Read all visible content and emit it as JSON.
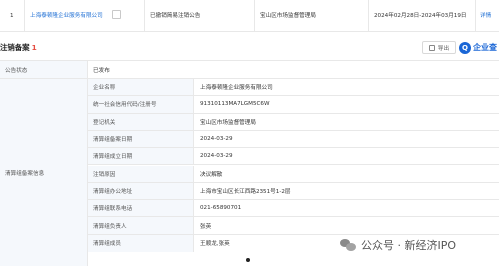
{
  "top_row": {
    "index": "1",
    "company": "上海泰顿隆企业服务有限公司",
    "status": "已撤销简易注销公告",
    "authority": "宝山区市场监督管理局",
    "period": "2024年02月28日-2024年03月19日",
    "action": "详情"
  },
  "section": {
    "title": "注销备案",
    "count": "1",
    "export_label": "导出",
    "brand": "企业查"
  },
  "announcement": {
    "label": "公告状态",
    "value": "已发布"
  },
  "group_label": "清算组备案信息",
  "rows": [
    {
      "key": "企业名称",
      "value": "上海泰顿隆企业服务有限公司"
    },
    {
      "key": "统一社会信用代码/注册号",
      "value": "91310113MA7LGM5C6W"
    },
    {
      "key": "登记机关",
      "value": "宝山区市场监督管理局"
    },
    {
      "key": "清算组备案日期",
      "value": "2024-03-29"
    },
    {
      "key": "清算组成立日期",
      "value": "2024-03-29"
    },
    {
      "key": "注销原因",
      "value": "决议解散"
    },
    {
      "key": "清算组办公地址",
      "value": "上海市宝山区长江西路2351号1-2层"
    },
    {
      "key": "清算组联系电话",
      "value": "021-65890701"
    },
    {
      "key": "清算组负责人",
      "value": "张英"
    },
    {
      "key": "清算组成员",
      "value": "王顺龙,张英"
    }
  ],
  "watermark": "公众号 · 新经济IPO",
  "colors": {
    "link": "#1f6fd4",
    "count": "#e54d42",
    "label_bg": "#f5f8fc",
    "border": "#e8e8e8",
    "brand": "#1a66d6"
  }
}
